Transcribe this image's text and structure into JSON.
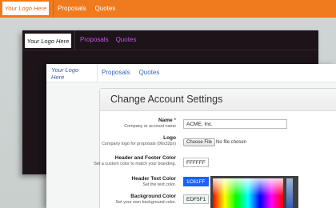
{
  "windows": [
    {
      "logo": "Your Logo Here",
      "nav": [
        "Proposals",
        "Quotes"
      ],
      "colors": {
        "header": "#f07a1e",
        "nav_text": "#ffffff"
      }
    },
    {
      "logo": "Your Logo Here",
      "nav": [
        "Proposals",
        "Quotes"
      ],
      "colors": {
        "header": "#1c1418",
        "nav_text": "#c455e6"
      }
    },
    {
      "logo": "Your Logo Here",
      "nav": [
        "Proposals",
        "Quotes"
      ],
      "colors": {
        "header": "#ffffff",
        "nav_text": "#3866b8"
      }
    }
  ],
  "settings": {
    "title": "Change Account Settings",
    "fields": {
      "name": {
        "label": "Name",
        "required_mark": "*",
        "help": "Company or account name",
        "value": "ACME, Inc."
      },
      "logo": {
        "label": "Logo",
        "help": "Company logo for proposals (96x32px)",
        "button": "Choose File",
        "status": "No file chosen"
      },
      "header_footer_color": {
        "label": "Header and Footer Color",
        "help": "Set a custom color to match your branding.",
        "value": "FFFFFF"
      },
      "header_text_color": {
        "label": "Header Text Color",
        "help": "Set the text color.",
        "value": "1C61FF"
      },
      "background_color": {
        "label": "Background Color",
        "help": "Set your own background color.",
        "value": "EDF5F1"
      }
    }
  }
}
